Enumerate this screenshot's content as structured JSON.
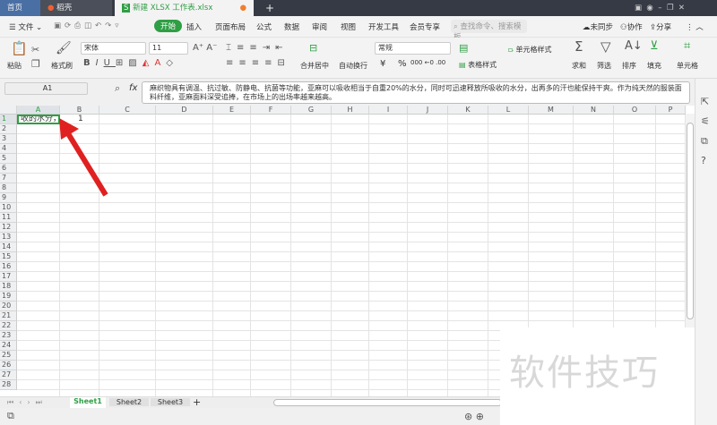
{
  "titlebar": {
    "tabs": [
      {
        "label": "首页"
      },
      {
        "label": "稻壳"
      },
      {
        "label": "新建 XLSX 工作表.xlsx"
      }
    ],
    "new_tab": "+"
  },
  "menu": {
    "file": "文件",
    "items": [
      "开始",
      "插入",
      "页面布局",
      "公式",
      "数据",
      "审阅",
      "视图",
      "开发工具",
      "会员专享"
    ],
    "search_placeholder": "查找命令、搜索模板",
    "sync": "未同步",
    "collab": "协作",
    "share": "分享"
  },
  "ribbon": {
    "paste": "粘贴",
    "format_painter": "格式刷",
    "font": "宋体",
    "size": "11",
    "merge": "合并居中",
    "wrap": "自动换行",
    "number_format": "常规",
    "currency": "¥",
    "percent": "%",
    "table_style": "表格样式",
    "cell_style": "单元格样式",
    "sum": "求和",
    "filter": "筛选",
    "sort": "排序",
    "fill": "填充",
    "cell": "单元格"
  },
  "formula": {
    "name_box": "A1",
    "fx": "fx",
    "content": "麻织物具有调温、抗过敏、防静电、抗菌等功能，亚麻可以吸收相当于自重20%的水分，同时可迅速释放所吸收的水分，出再多的汗也能保持干爽。作为纯天然的服装面料纤维，亚麻面料深受追捧，在市场上的出场率越来越高。"
  },
  "grid": {
    "columns": [
      "A",
      "B",
      "C",
      "D",
      "E",
      "F",
      "G",
      "H",
      "I",
      "J",
      "K",
      "L",
      "M",
      "N",
      "O",
      "P"
    ],
    "row_count": 28,
    "cells": {
      "A1": "收的水分，",
      "B1": "1"
    }
  },
  "sheets": {
    "tabs": [
      "Sheet1",
      "Sheet2",
      "Sheet3"
    ],
    "active": "Sheet1",
    "add": "+"
  },
  "watermark": "软件技巧",
  "colors": {
    "accent": "#2f9e44",
    "titlebar": "#353a45",
    "arrow": "#e02020"
  }
}
